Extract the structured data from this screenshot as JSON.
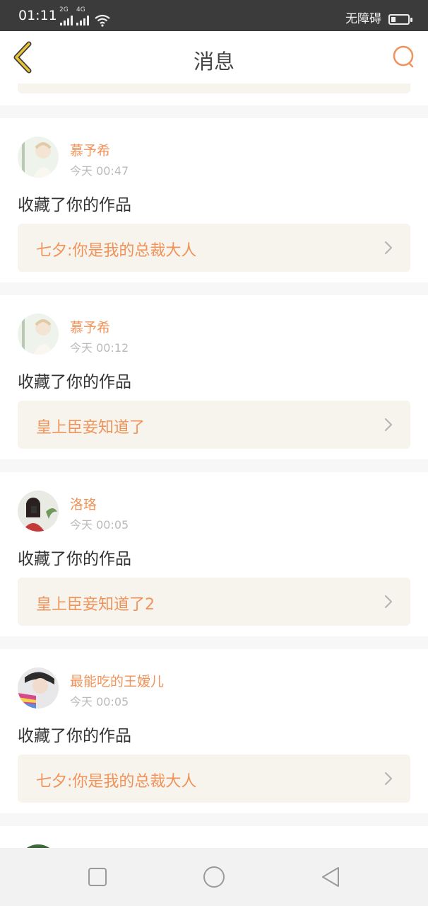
{
  "status_bar": {
    "time": "01:11",
    "signal1": "2G",
    "signal2": "4G",
    "right_label": "无障碍"
  },
  "header": {
    "title": "消息",
    "back_icon": "chevron-left-icon",
    "search_icon": "search-icon",
    "accent_color": "#f0935a",
    "back_color": "#e8c43a"
  },
  "messages": [
    {
      "user": "慕予希",
      "time": "今天 00:47",
      "action": "收藏了你的作品",
      "work": "七夕:你是我的总裁大人"
    },
    {
      "user": "慕予希",
      "time": "今天 00:12",
      "action": "收藏了你的作品",
      "work": "皇上臣妾知道了"
    },
    {
      "user": "洛珞",
      "time": "今天 00:05",
      "action": "收藏了你的作品",
      "work": "皇上臣妾知道了2"
    },
    {
      "user": "最能吃的王嫒儿",
      "time": "今天 00:05",
      "action": "收藏了你的作品",
      "work": "七夕:你是我的总裁大人"
    }
  ],
  "nav": {
    "square_icon": "recent-apps-icon",
    "circle_icon": "home-icon",
    "triangle_icon": "back-triangle-icon"
  }
}
